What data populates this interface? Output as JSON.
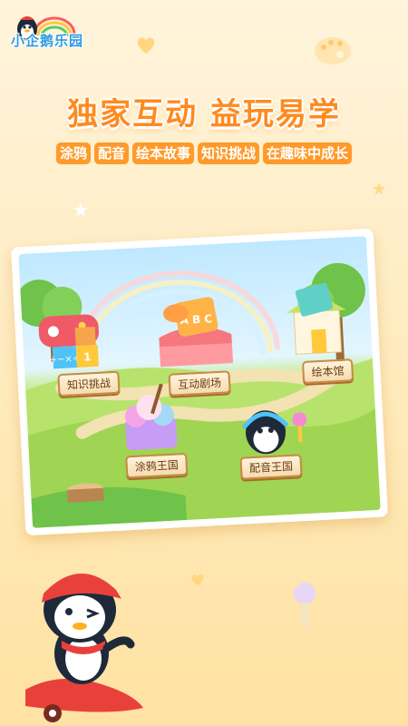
{
  "app": {
    "logo_text": "小企鹅乐园"
  },
  "hero": {
    "headline": "独家互动 益玩易学",
    "features": [
      "涂鸦",
      "配音",
      "绘本故事",
      "知识挑战",
      "在趣味中成长"
    ]
  },
  "scene": {
    "signs": {
      "knowledge": "知识挑战",
      "theater": "互动剧场",
      "library": "绘本馆",
      "doodle": "涂鸦王国",
      "dubbing": "配音王国"
    },
    "block_letters": "A B C",
    "cube_digit": "1",
    "cube_ops": "+−×÷"
  },
  "colors": {
    "accent": "#ff8a1f",
    "chip": "#ff9a2a",
    "logo": "#2f9be0"
  }
}
